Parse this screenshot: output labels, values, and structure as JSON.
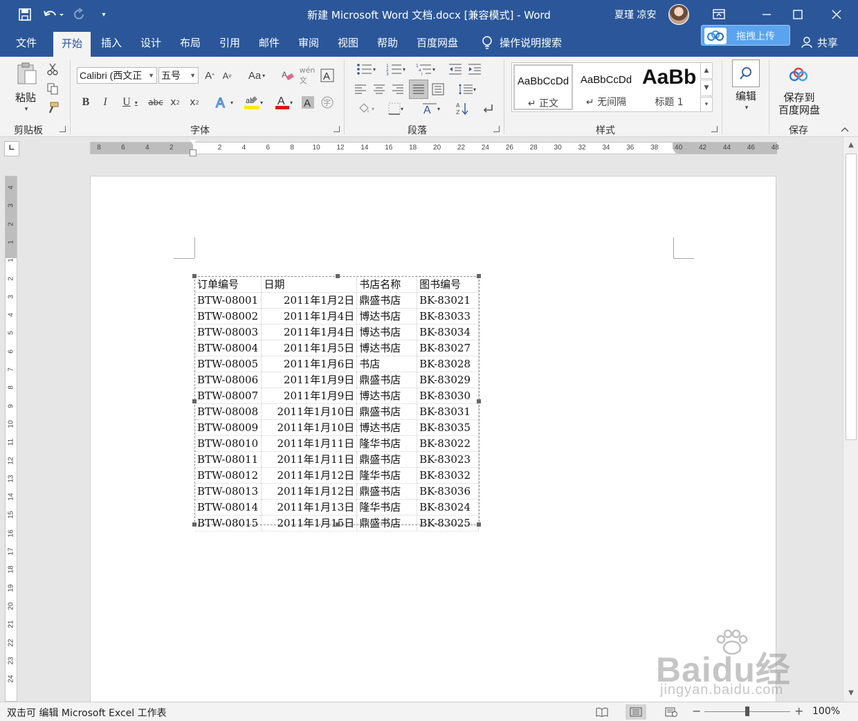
{
  "window": {
    "title": "新建 Microsoft Word 文档.docx [兼容模式]  -  Word",
    "user": "夏瑾 凉安",
    "upload_button": "拖拽上传"
  },
  "tabs": [
    "文件",
    "开始",
    "插入",
    "设计",
    "布局",
    "引用",
    "邮件",
    "审阅",
    "视图",
    "帮助",
    "百度网盘"
  ],
  "tell_me": "操作说明搜索",
  "share": "共享",
  "ribbon": {
    "clipboard": {
      "label": "剪贴板",
      "paste": "粘贴"
    },
    "font": {
      "label": "字体",
      "font_name": "Calibri (西文正",
      "font_size": "五号"
    },
    "paragraph": {
      "label": "段落"
    },
    "styles": {
      "label": "样式",
      "items": [
        {
          "sample": "AaBbCcDd",
          "name": "↵ 正文"
        },
        {
          "sample": "AaBbCcDd",
          "name": "↵ 无间隔"
        },
        {
          "sample": "AaBb",
          "name": "标题 1"
        }
      ]
    },
    "editing": {
      "label": "编辑"
    },
    "save": {
      "label": "保存",
      "button": "保存到 百度网盘",
      "line1": "保存到",
      "line2": "百度网盘"
    }
  },
  "ruler": {
    "labels": [
      "8",
      "6",
      "4",
      "2",
      "",
      "2",
      "4",
      "6",
      "8",
      "10",
      "12",
      "14",
      "16",
      "18",
      "20",
      "22",
      "24",
      "26",
      "28",
      "30",
      "32",
      "34",
      "36",
      "38",
      "40",
      "42",
      "44",
      "46",
      "48"
    ],
    "vlabels": [
      "4",
      "3",
      "2",
      "1",
      "1",
      "2",
      "3",
      "4",
      "5",
      "6",
      "7",
      "8",
      "9",
      "10",
      "11",
      "12",
      "13",
      "14",
      "15",
      "16",
      "17",
      "18",
      "19",
      "20",
      "21",
      "22",
      "23",
      "24"
    ]
  },
  "table": {
    "headers": [
      "订单编号",
      "日期",
      "书店名称",
      "图书编号"
    ],
    "rows": [
      [
        "BTW-08001",
        "2011年1月2日",
        "鼎盛书店",
        "BK-83021"
      ],
      [
        "BTW-08002",
        "2011年1月4日",
        "博达书店",
        "BK-83033"
      ],
      [
        "BTW-08003",
        "2011年1月4日",
        "博达书店",
        "BK-83034"
      ],
      [
        "BTW-08004",
        "2011年1月5日",
        "博达书店",
        "BK-83027"
      ],
      [
        "BTW-08005",
        "2011年1月6日",
        "书店",
        "BK-83028"
      ],
      [
        "BTW-08006",
        "2011年1月9日",
        "鼎盛书店",
        "BK-83029"
      ],
      [
        "BTW-08007",
        "2011年1月9日",
        "博达书店",
        "BK-83030"
      ],
      [
        "BTW-08008",
        "2011年1月10日",
        "鼎盛书店",
        "BK-83031"
      ],
      [
        "BTW-08009",
        "2011年1月10日",
        "博达书店",
        "BK-83035"
      ],
      [
        "BTW-08010",
        "2011年1月11日",
        "隆华书店",
        "BK-83022"
      ],
      [
        "BTW-08011",
        "2011年1月11日",
        "鼎盛书店",
        "BK-83023"
      ],
      [
        "BTW-08012",
        "2011年1月12日",
        "隆华书店",
        "BK-83032"
      ],
      [
        "BTW-08013",
        "2011年1月12日",
        "鼎盛书店",
        "BK-83036"
      ],
      [
        "BTW-08014",
        "2011年1月13日",
        "隆华书店",
        "BK-83024"
      ],
      [
        "BTW-08015",
        "2011年1月15日",
        "鼎盛书店",
        "BK-83025"
      ]
    ]
  },
  "status": {
    "text": "双击可 编辑 Microsoft Excel 工作表",
    "zoom": "100%",
    "zoom_level": 1.0
  },
  "watermark": {
    "main": "Baidu经验",
    "sub": "jingyan.baidu.com"
  },
  "colors": {
    "titlebar": "#2b579a",
    "ribbon": "#f3f3f3",
    "upload": "#5aa4ef"
  }
}
